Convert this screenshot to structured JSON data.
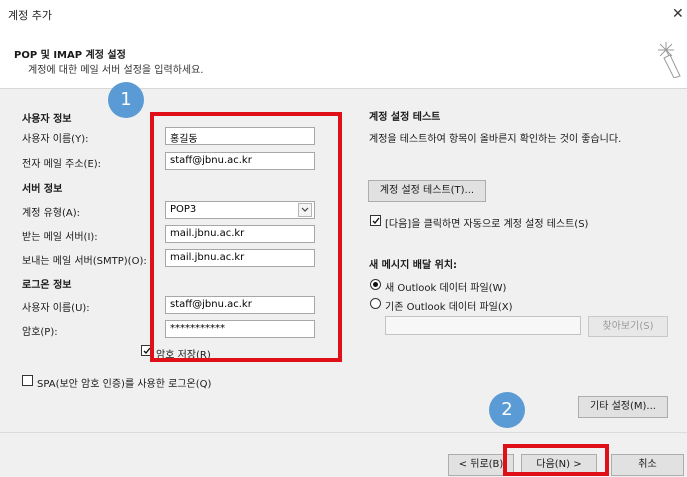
{
  "window": {
    "title": "계정 추가",
    "close_glyph": "✕"
  },
  "header": {
    "title": "POP 및 IMAP 계정 설정",
    "subtitle": "계정에 대한 메일 서버 설정을 입력하세요.",
    "icon": "wand-sparkle-icon"
  },
  "user_info": {
    "section": "사용자 정보",
    "name_label": "사용자 이름(Y):",
    "name_value": "홍길동",
    "email_label": "전자 메일 주소(E):",
    "email_value": "staff@jbnu.ac.kr"
  },
  "server_info": {
    "section": "서버 정보",
    "type_label": "계정 유형(A):",
    "type_value": "POP3",
    "incoming_label": "받는 메일 서버(I):",
    "incoming_value": "mail.jbnu.ac.kr",
    "outgoing_label": "보내는 메일 서버(SMTP)(O):",
    "outgoing_value": "mail.jbnu.ac.kr"
  },
  "logon_info": {
    "section": "로그온 정보",
    "user_label": "사용자 이름(U):",
    "user_value": "staff@jbnu.ac.kr",
    "password_label": "암호(P):",
    "password_value": "***********",
    "remember_label": "암호 저장(R)",
    "remember_checked": true,
    "spa_label": "SPA(보안 암호 인증)를 사용한 로그온(Q)",
    "spa_checked": false
  },
  "test": {
    "section": "계정 설정 테스트",
    "description": "계정을 테스트하여 항목이 올바른지 확인하는 것이 좋습니다.",
    "button": "계정 설정 테스트(T)...",
    "auto_label": "[다음]을 클릭하면 자동으로 계정 설정 테스트(S)",
    "auto_checked": true
  },
  "delivery": {
    "section": "새 메시지 배달 위치:",
    "option_new": "새 Outlook 데이터 파일(W)",
    "option_existing": "기존 Outlook 데이터 파일(X)",
    "selected": "new",
    "browse_button": "찾아보기(S)"
  },
  "more_settings_button": "기타 설정(M)...",
  "footer": {
    "back_button": "< 뒤로(B)",
    "next_button": "다음(N) >",
    "cancel_button": "취소"
  },
  "annotations": {
    "step1": "1",
    "step2": "2",
    "highlight_color": "#e0101a",
    "step_color": "#5b9bd5"
  }
}
